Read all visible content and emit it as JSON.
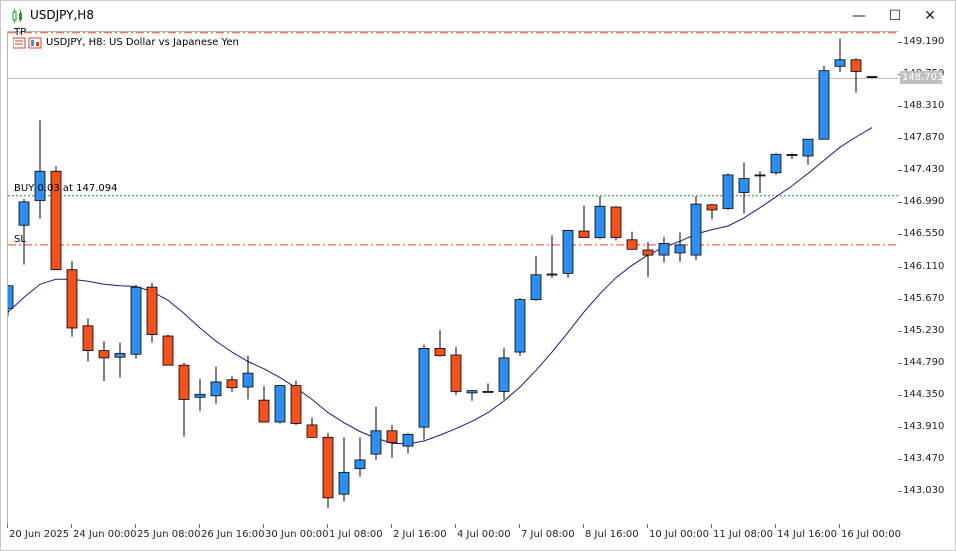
{
  "window": {
    "title": "USDJPY,H8",
    "buttons": {
      "minimize": "—",
      "maximize": "☐",
      "close": "✕"
    }
  },
  "chart_header": {
    "description": "USDJPY, H8:  US Dollar vs Japanese Yen"
  },
  "levels": {
    "tp_label": "TP",
    "buy_label": "BUY 0.03 at 147.094",
    "sl_label": "SL",
    "tp_price": 149.33,
    "buy_price": 147.094,
    "sl_price": 146.42,
    "current_price": 148.703,
    "current_price_text": "148.703",
    "colors": {
      "tp_sl": "#e8492a",
      "buy": "#2e8b2e",
      "current": "#c0c0c0"
    }
  },
  "price_axis": [
    "149.190",
    "148.750",
    "148.310",
    "147.870",
    "147.430",
    "146.990",
    "146.550",
    "146.110",
    "145.670",
    "145.230",
    "144.790",
    "144.350",
    "143.910",
    "143.470",
    "143.030"
  ],
  "time_axis": [
    "20 Jun 2025",
    "24 Jun 00:00",
    "25 Jun 08:00",
    "26 Jun 16:00",
    "30 Jun 00:00",
    "1 Jul 08:00",
    "2 Jul 16:00",
    "4 Jul 00:00",
    "7 Jul 08:00",
    "8 Jul 16:00",
    "10 Jul 00:00",
    "11 Jul 08:00",
    "14 Jul 16:00",
    "16 Jul 00:00"
  ],
  "chart_data": {
    "type": "candlestick",
    "symbol": "USDJPY",
    "timeframe": "H8",
    "ylim": [
      142.75,
      149.4
    ],
    "colors": {
      "bull": "#2f8fef",
      "bear": "#f2521d",
      "ma": "#1a1a8a"
    },
    "candles": [
      {
        "o": 145.55,
        "h": 145.86,
        "l": 145.45,
        "c": 145.86
      },
      {
        "o": 146.69,
        "h": 147.05,
        "l": 146.15,
        "c": 147.01
      },
      {
        "o": 147.03,
        "h": 148.13,
        "l": 146.78,
        "c": 147.43
      },
      {
        "o": 147.43,
        "h": 147.5,
        "l": 146.08,
        "c": 146.08
      },
      {
        "o": 146.08,
        "h": 146.2,
        "l": 145.16,
        "c": 145.28
      },
      {
        "o": 145.31,
        "h": 145.41,
        "l": 144.82,
        "c": 144.97
      },
      {
        "o": 144.97,
        "h": 145.1,
        "l": 144.55,
        "c": 144.87
      },
      {
        "o": 144.88,
        "h": 145.08,
        "l": 144.6,
        "c": 144.93
      },
      {
        "o": 144.92,
        "h": 145.87,
        "l": 144.86,
        "c": 145.84
      },
      {
        "o": 145.84,
        "h": 145.9,
        "l": 145.08,
        "c": 145.19
      },
      {
        "o": 145.17,
        "h": 145.19,
        "l": 144.77,
        "c": 144.77
      },
      {
        "o": 144.77,
        "h": 144.8,
        "l": 143.79,
        "c": 144.3
      },
      {
        "o": 144.33,
        "h": 144.58,
        "l": 144.14,
        "c": 144.37
      },
      {
        "o": 144.35,
        "h": 144.75,
        "l": 144.24,
        "c": 144.54
      },
      {
        "o": 144.57,
        "h": 144.62,
        "l": 144.4,
        "c": 144.46
      },
      {
        "o": 144.47,
        "h": 144.9,
        "l": 144.3,
        "c": 144.66
      },
      {
        "o": 144.29,
        "h": 144.48,
        "l": 143.98,
        "c": 143.99
      },
      {
        "o": 143.99,
        "h": 144.49,
        "l": 143.97,
        "c": 144.49
      },
      {
        "o": 144.49,
        "h": 144.56,
        "l": 143.95,
        "c": 143.97
      },
      {
        "o": 143.95,
        "h": 144.05,
        "l": 143.8,
        "c": 143.78
      },
      {
        "o": 143.78,
        "h": 143.84,
        "l": 142.81,
        "c": 142.95
      },
      {
        "o": 143.0,
        "h": 143.78,
        "l": 142.9,
        "c": 143.3
      },
      {
        "o": 143.35,
        "h": 143.78,
        "l": 143.24,
        "c": 143.47
      },
      {
        "o": 143.55,
        "h": 144.2,
        "l": 143.47,
        "c": 143.87
      },
      {
        "o": 143.87,
        "h": 143.95,
        "l": 143.5,
        "c": 143.71
      },
      {
        "o": 143.66,
        "h": 143.84,
        "l": 143.56,
        "c": 143.82
      },
      {
        "o": 143.92,
        "h": 145.05,
        "l": 143.75,
        "c": 145.0
      },
      {
        "o": 145.0,
        "h": 145.25,
        "l": 144.89,
        "c": 144.9
      },
      {
        "o": 144.91,
        "h": 145.02,
        "l": 144.36,
        "c": 144.41
      },
      {
        "o": 144.39,
        "h": 144.43,
        "l": 144.28,
        "c": 144.42
      },
      {
        "o": 144.41,
        "h": 144.52,
        "l": 144.41,
        "c": 144.4
      },
      {
        "o": 144.41,
        "h": 145.01,
        "l": 144.3,
        "c": 144.87
      },
      {
        "o": 144.95,
        "h": 145.69,
        "l": 144.9,
        "c": 145.67
      },
      {
        "o": 145.67,
        "h": 146.27,
        "l": 145.65,
        "c": 146.01
      },
      {
        "o": 146.02,
        "h": 146.55,
        "l": 145.97,
        "c": 146.01
      },
      {
        "o": 146.03,
        "h": 146.6,
        "l": 145.97,
        "c": 146.62
      },
      {
        "o": 146.61,
        "h": 146.96,
        "l": 146.6,
        "c": 146.52
      },
      {
        "o": 146.52,
        "h": 147.09,
        "l": 146.5,
        "c": 146.95
      },
      {
        "o": 146.94,
        "h": 146.95,
        "l": 146.48,
        "c": 146.52
      },
      {
        "o": 146.49,
        "h": 146.6,
        "l": 146.36,
        "c": 146.36
      },
      {
        "o": 146.35,
        "h": 146.46,
        "l": 145.98,
        "c": 146.28
      },
      {
        "o": 146.28,
        "h": 146.53,
        "l": 146.18,
        "c": 146.44
      },
      {
        "o": 146.31,
        "h": 146.59,
        "l": 146.19,
        "c": 146.42
      },
      {
        "o": 146.28,
        "h": 147.09,
        "l": 146.21,
        "c": 146.98
      },
      {
        "o": 146.97,
        "h": 146.98,
        "l": 146.77,
        "c": 146.9
      },
      {
        "o": 146.92,
        "h": 147.4,
        "l": 146.9,
        "c": 147.38
      },
      {
        "o": 147.14,
        "h": 147.55,
        "l": 146.85,
        "c": 147.33
      },
      {
        "o": 147.37,
        "h": 147.43,
        "l": 147.13,
        "c": 147.38
      },
      {
        "o": 147.41,
        "h": 147.68,
        "l": 147.38,
        "c": 147.66
      },
      {
        "o": 147.66,
        "h": 147.68,
        "l": 147.6,
        "c": 147.65
      },
      {
        "o": 147.64,
        "h": 147.87,
        "l": 147.52,
        "c": 147.87
      },
      {
        "o": 147.87,
        "h": 148.88,
        "l": 147.87,
        "c": 148.81
      },
      {
        "o": 148.87,
        "h": 149.25,
        "l": 148.79,
        "c": 148.96
      },
      {
        "o": 148.96,
        "h": 148.98,
        "l": 148.51,
        "c": 148.8
      },
      {
        "o": 148.73,
        "h": 148.74,
        "l": 148.71,
        "c": 148.73
      }
    ],
    "ma": [
      145.5,
      145.7,
      145.88,
      145.95,
      145.95,
      145.92,
      145.88,
      145.86,
      145.85,
      145.78,
      145.66,
      145.48,
      145.28,
      145.1,
      144.95,
      144.82,
      144.72,
      144.6,
      144.46,
      144.3,
      144.12,
      143.98,
      143.86,
      143.77,
      143.7,
      143.69,
      143.73,
      143.81,
      143.9,
      144.0,
      144.12,
      144.28,
      144.47,
      144.7,
      144.95,
      145.22,
      145.5,
      145.75,
      145.97,
      146.14,
      146.28,
      146.39,
      146.47,
      146.57,
      146.63,
      146.68,
      146.79,
      146.93,
      147.08,
      147.23,
      147.4,
      147.58,
      147.76,
      147.9,
      148.03
    ]
  }
}
